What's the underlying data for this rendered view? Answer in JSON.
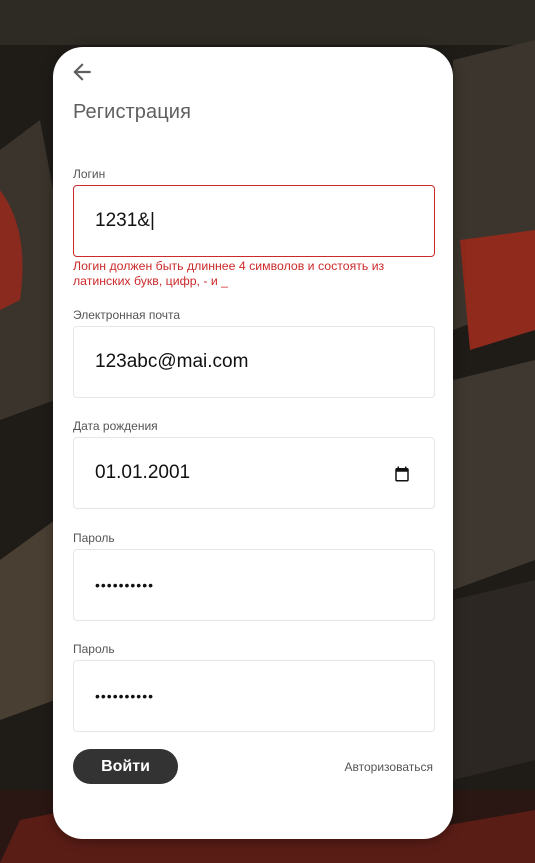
{
  "form": {
    "title": "Регистрация",
    "login": {
      "label": "Логин",
      "value": "1231&|",
      "error": "Логин должен быть длиннее 4 символов и состоять из латинских букв, цифр, - и _"
    },
    "email": {
      "label": "Электронная почта",
      "value": "123abc@mai.com"
    },
    "birthdate": {
      "label": "Дата рождения",
      "value": "01.01.2001"
    },
    "password": {
      "label": "Пароль",
      "value": "••••••••••"
    },
    "password_confirm": {
      "label": "Пароль",
      "value": "••••••••••"
    },
    "submit_label": "Войти",
    "auth_link_label": "Авторизоваться"
  },
  "colors": {
    "error": "#cc2a2a",
    "button_bg": "#333333",
    "card_bg": "#ffffff"
  },
  "icons": {
    "back": "arrow-left-icon",
    "calendar": "calendar-icon"
  }
}
